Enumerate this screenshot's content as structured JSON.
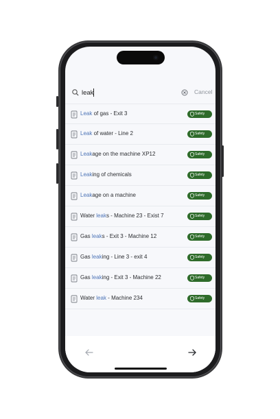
{
  "search": {
    "value": "leak",
    "cancel_label": "Cancel"
  },
  "results": [
    {
      "match": "Leak",
      "rest": " of gas - Exit 3",
      "pre": "",
      "badge": "Safety"
    },
    {
      "match": "Leak",
      "rest": " of water - Line 2",
      "pre": "",
      "badge": "Safety"
    },
    {
      "match": "Leak",
      "rest": "age on the machine XP12",
      "pre": "",
      "badge": "Safety"
    },
    {
      "match": "Leak",
      "rest": "ing of chemicals",
      "pre": "",
      "badge": "Safety"
    },
    {
      "match": "Leak",
      "rest": "age on a machine",
      "pre": "",
      "badge": "Safety"
    },
    {
      "pre": "Water ",
      "match": "leak",
      "rest": "s - Machine 23 - Exist 7",
      "badge": "Safety"
    },
    {
      "pre": "Gas ",
      "match": "leak",
      "rest": "s - Exit 3 - Machine 12",
      "badge": "Safety"
    },
    {
      "pre": "Gas ",
      "match": "leak",
      "rest": "ing - Line 3 - exit 4",
      "badge": "Safety"
    },
    {
      "pre": "Gas ",
      "match": "leak",
      "rest": "ing - Exit 3 - Machine 22",
      "badge": "Safety"
    },
    {
      "pre": "Water ",
      "match": "leak",
      "rest": " - Machine 234",
      "badge": "Safety"
    }
  ],
  "icons": {
    "search": "search-icon",
    "clear": "clear-icon",
    "result": "document-icon",
    "badge": "shield-icon",
    "back": "arrow-left-icon",
    "forward": "arrow-right-icon"
  },
  "colors": {
    "highlight": "#4d74b7",
    "badge_bg": "#2e6b2a",
    "cancel": "#8f949c"
  }
}
